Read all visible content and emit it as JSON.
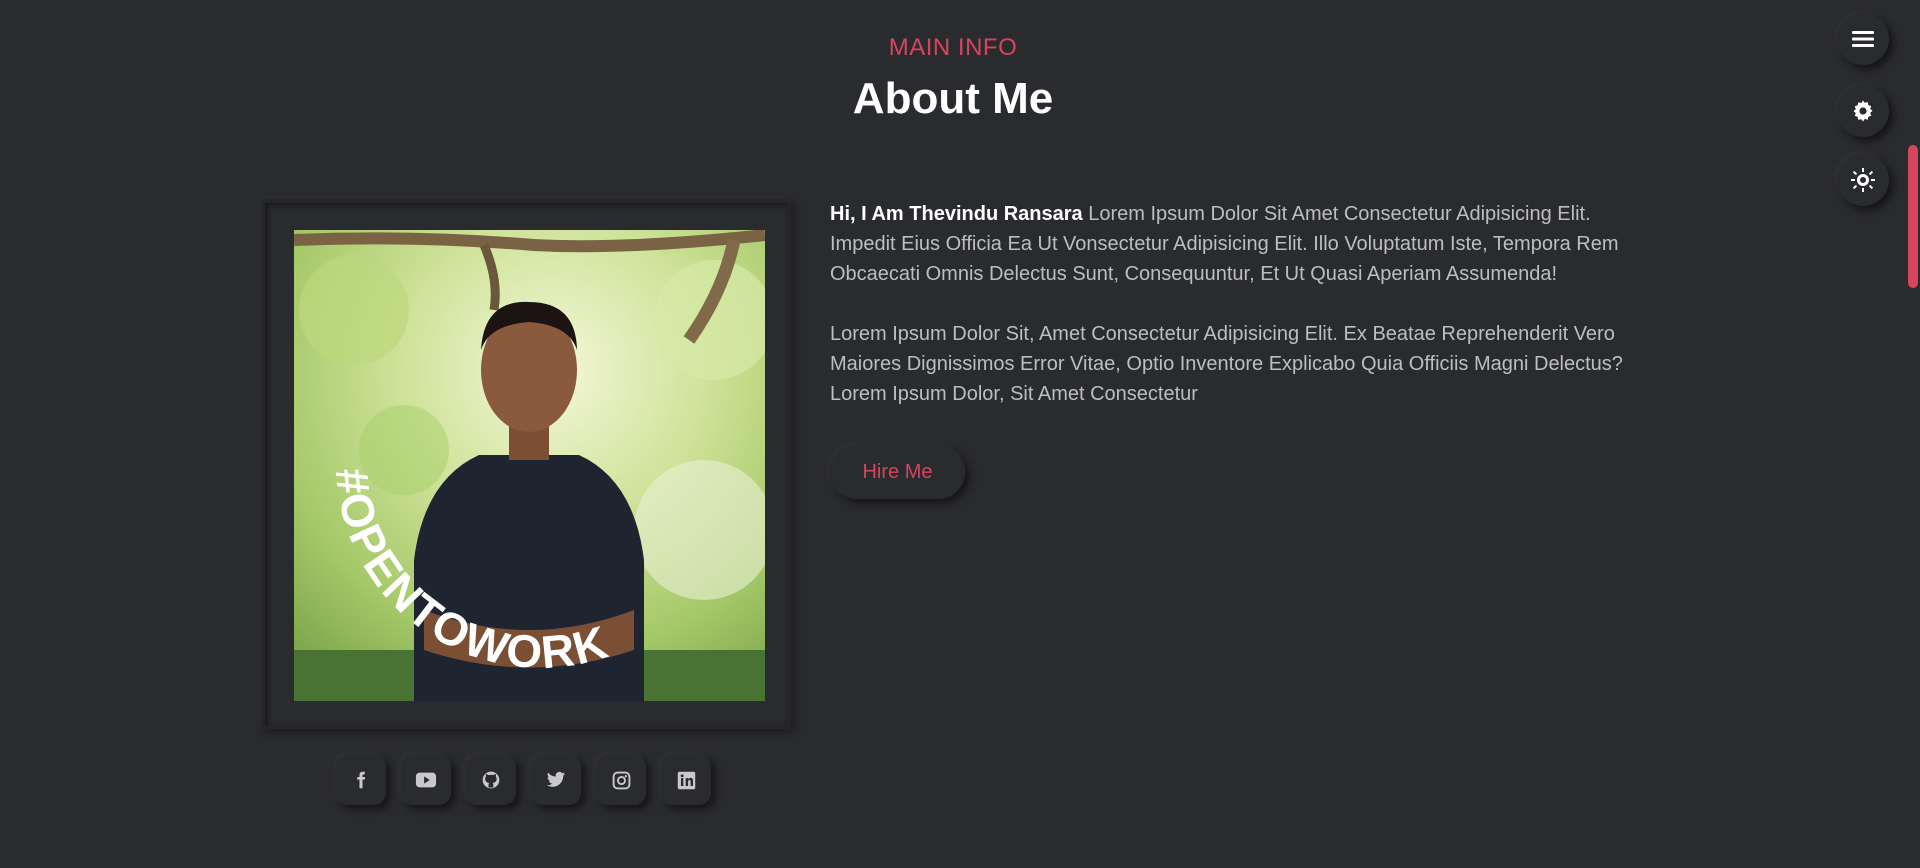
{
  "header": {
    "subtitle": "MAIN INFO",
    "title": "About Me"
  },
  "profile": {
    "photo_badge_text": "#OPENTOWORK"
  },
  "bio": {
    "greeting": "Hi, I Am Thevindu Ransara",
    "paragraph1": " Lorem Ipsum Dolor Sit Amet Consectetur Adipisicing Elit. Impedit Eius Officia Ea Ut Vonsectetur Adipisicing Elit. Illo Voluptatum Iste, Tempora Rem Obcaecati Omnis Delectus Sunt, Consequuntur, Et Ut Quasi Aperiam Assumenda!",
    "paragraph2": "Lorem Ipsum Dolor Sit, Amet Consectetur Adipisicing Elit. Ex Beatae Reprehenderit Vero Maiores Dignissimos Error Vitae, Optio Inventore Explicabo Quia Officiis Magni Delectus? Lorem Ipsum Dolor, Sit Amet Consectetur"
  },
  "actions": {
    "hire_label": "Hire Me"
  },
  "social": [
    "facebook-icon",
    "youtube-icon",
    "github-icon",
    "twitter-icon",
    "instagram-icon",
    "linkedin-icon"
  ],
  "floating_controls": [
    "menu-icon",
    "settings-icon",
    "theme-toggle-icon"
  ],
  "colors": {
    "accent": "#d6455e",
    "background": "#2a2b2f",
    "text": "#bdbec4",
    "photo_badge_green": "#4a7233"
  }
}
